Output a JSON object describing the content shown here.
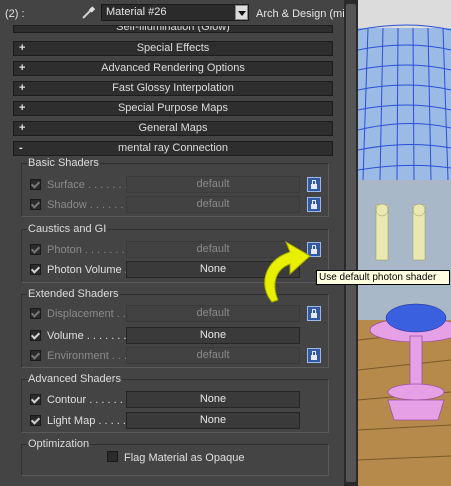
{
  "toolbar": {
    "slot_label": "(2) :",
    "material_name": "Material #26",
    "material_type": "Arch & Design (mi)"
  },
  "rollups": [
    {
      "sign": "+",
      "label": "Self-Illumination (Glow)"
    },
    {
      "sign": "+",
      "label": "Special Effects"
    },
    {
      "sign": "+",
      "label": "Advanced Rendering Options"
    },
    {
      "sign": "+",
      "label": "Fast Glossy Interpolation"
    },
    {
      "sign": "+",
      "label": "Special Purpose Maps"
    },
    {
      "sign": "+",
      "label": "General Maps"
    },
    {
      "sign": "-",
      "label": "mental ray Connection"
    }
  ],
  "groups": {
    "basic": {
      "title": "Basic Shaders",
      "rows": [
        {
          "label": "Surface . . . . . . . .",
          "value": "default"
        },
        {
          "label": "Shadow . . . . . . . .",
          "value": "default"
        }
      ]
    },
    "caustics": {
      "title": "Caustics and GI",
      "rows": [
        {
          "label": "Photon . . . . . . . .",
          "value": "default"
        },
        {
          "label": "Photon Volume . .",
          "value": "None"
        }
      ]
    },
    "extended": {
      "title": "Extended Shaders",
      "rows": [
        {
          "label": "Displacement . . .",
          "value": "default"
        },
        {
          "label": "Volume . . . . . . .",
          "value": "None"
        },
        {
          "label": "Environment . . . .",
          "value": "default"
        }
      ]
    },
    "advanced": {
      "title": "Advanced Shaders",
      "rows": [
        {
          "label": "Contour . . . . . .",
          "value": "None"
        },
        {
          "label": "Light Map . . . . .",
          "value": "None"
        }
      ]
    },
    "optimization": {
      "title": "Optimization",
      "flag_label": "Flag Material as Opaque"
    }
  },
  "tooltip": "Use default photon shader",
  "colors": {
    "panel_bg": "#444444",
    "rollup_bg": "#2e2e2e",
    "lock_button": "#2f5aa8",
    "tooltip_bg": "#ffffe1",
    "arrow": "#e8f000",
    "viewport_mesh": "#2a4fd8",
    "viewport_pink": "#e6a0e6"
  }
}
